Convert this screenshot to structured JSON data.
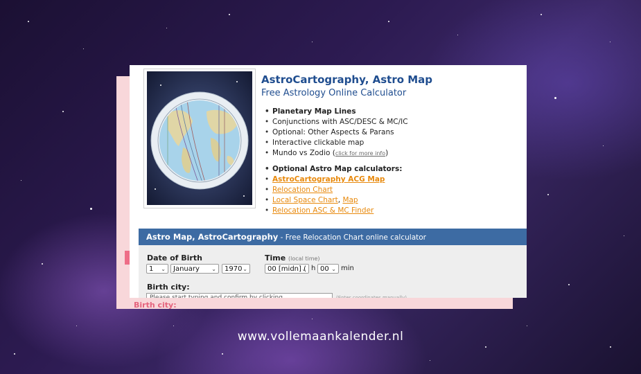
{
  "header": {
    "title": "AstroCartography, Astro Map",
    "subtitle": "Free Astrology Online Calculator"
  },
  "features": [
    "Planetary Map Lines",
    "Conjunctions with ASC/DESC & MC/IC",
    "Optional: Other Aspects & Parans",
    "Interactive clickable map"
  ],
  "feature_mundo": {
    "text": "Mundo vs Zodio (",
    "link": "click for more info",
    "close": ")"
  },
  "optional": {
    "heading": "Optional Astro Map calculators:",
    "acg_map": "AstroCartography ACG Map",
    "relocation_chart": "Relocation Chart",
    "local_space_chart": "Local Space Chart",
    "separator": ", ",
    "map": "Map",
    "asc_mc_finder": "Relocation ASC & MC Finder"
  },
  "form": {
    "header_lead": "Astro Map, AstroCartography",
    "header_rest": " - Free Relocation Chart online calculator",
    "date_label": "Date of Birth",
    "day": "1",
    "month": "January",
    "year": "1970",
    "time_label": "Time",
    "time_hint": "(local time)",
    "hour": "00 [midn] (",
    "hour_unit": "h",
    "minute": "00",
    "minute_unit": "min",
    "city_label": "Birth city:",
    "city_placeholder": "Please start typing and confirm by clicking",
    "coords_hint": "(Enter coordinates manually)"
  },
  "background_label": "Birth city:",
  "watermark": "www.vollemaankalender.nl",
  "colors": {
    "title_blue": "#1f4d8f",
    "link_orange": "#e8890c",
    "form_header": "#3d6ba3",
    "pink_panel": "#f8d7da"
  },
  "icons": {
    "select_arrow": "chevron-down-icon",
    "bullet": "bullet-icon"
  }
}
